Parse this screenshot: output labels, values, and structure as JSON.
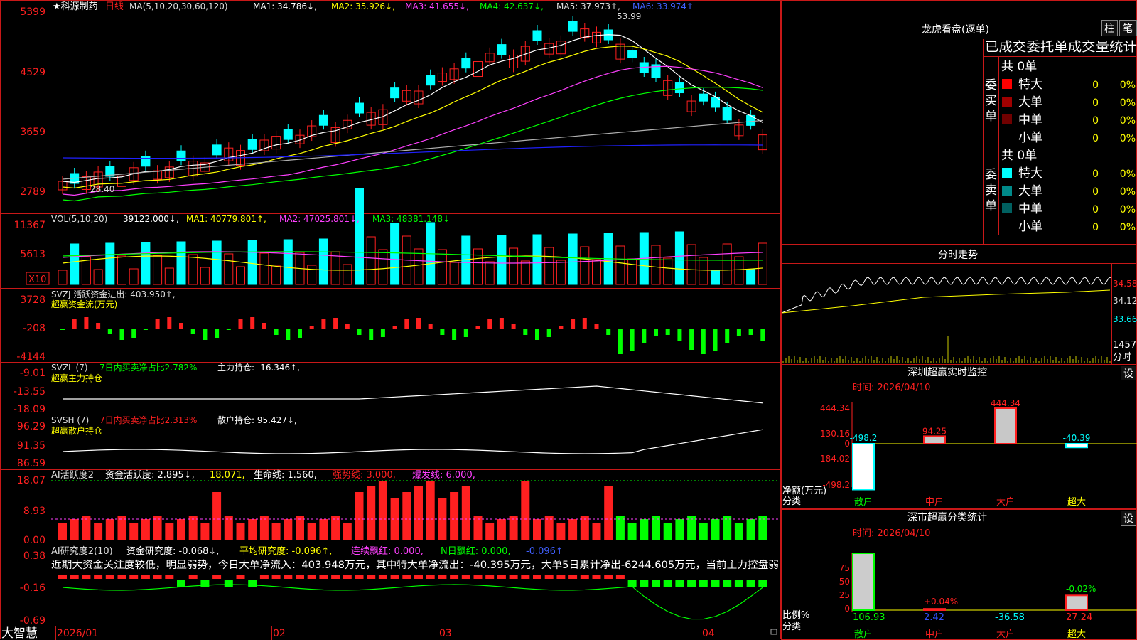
{
  "colors": {
    "up": "#ff2020",
    "down": "#00ffff",
    "grid": "#ff2020",
    "ma_white": "#ffffff",
    "ma_yellow": "#ffff00",
    "ma_magenta": "#ff40ff",
    "ma_green": "#00ff00",
    "ma_gray": "#b0b0b0",
    "ma_blue": "#2020ff"
  },
  "main": {
    "title": "★科源制药",
    "period": "日线",
    "ma_label": "MA(5,10,20,30,60,120)",
    "ma1": "MA1: 34.786↓,",
    "ma2": "MA2: 35.926↓,",
    "ma3": "MA3: 41.655↓,",
    "ma4": "MA4: 42.637↓,",
    "ma5": "MA5: 37.973↑,",
    "ma6": "MA6: 33.974↑",
    "high_mark": "53.99",
    "low_mark": "28.40",
    "y_ticks": [
      "5399",
      "4529",
      "3659",
      "2789"
    ]
  },
  "vol": {
    "label": "VOL(5,10,20)",
    "value": "39122.000↓,",
    "ma1": "MA1: 40779.801↑,",
    "ma2": "MA2: 47025.801↓,",
    "ma3": "MA3: 48381.148↓",
    "y_ticks": [
      "11367",
      "5613"
    ],
    "unit": "X10"
  },
  "svzj": {
    "label": "SVZJ  活跃资金进出: 403.950↑,",
    "sub": "超赢资金流(万元)",
    "y_ticks": [
      "3728",
      "-208",
      "-4144"
    ]
  },
  "svzl": {
    "label1": "SVZL (7)",
    "label2": "7日内买卖净占比2.782%",
    "label3": "主力持仓: -16.346↑,",
    "sub": "超赢主力持仓",
    "y_ticks": [
      "-9.01",
      "-13.55",
      "-18.09"
    ]
  },
  "svsh": {
    "label1": "SVSH (7)",
    "label2": "7日内买卖净占比2.313%",
    "label3": "散户持仓: 95.427↓,",
    "sub": "超赢散户持仓",
    "y_ticks": [
      "96.29",
      "91.35",
      "86.59"
    ]
  },
  "ai1": {
    "label1": "AI活跃度2",
    "label2": "资金活跃度: 2.895↓,",
    "label3": "18.071,",
    "label4": "生命线: 1.560,",
    "label5": "强势线: 3.000,",
    "label6": "爆发线: 6.000,",
    "y_ticks": [
      "18.07",
      "8.93",
      "0.00"
    ]
  },
  "ai2": {
    "label1": "AI研究度2(10)",
    "label2": "资金研究度: -0.068↓,",
    "label3": "平均研究度: -0.096↑,",
    "label4": "连续飘红: 0.000,",
    "label5": "N日飘红: 0.000,",
    "label6": "-0.096↑",
    "note": "近期大资金关注度较低，明显弱势，今日大单净流入：403.948万元，其中特大单净流出：-40.395万元，大单5日累计净出-6244.605万元，当前主力控盘弱",
    "y_ticks": [
      "0.38",
      "-0.16",
      "-0.69"
    ]
  },
  "xaxis": {
    "brand": "大智慧",
    "labels": [
      "2026/01",
      "02",
      "03",
      "04"
    ]
  },
  "lhb": {
    "title": "龙虎看盘(逐单)",
    "btn1": "柱",
    "btn2": "笔",
    "subtitle": "已成交委托单成交量统计",
    "buy_side": "委买单",
    "sell_side": "委卖单",
    "buy_total": "共 0单",
    "sell_total": "共 0单",
    "buy_rows": [
      {
        "name": "特大",
        "n": "0",
        "p": "0%",
        "color": "#ff0000"
      },
      {
        "name": "大单",
        "n": "0",
        "p": "0%",
        "color": "#a00000"
      },
      {
        "name": "中单",
        "n": "0",
        "p": "0%",
        "color": "#700000"
      },
      {
        "name": "小单",
        "n": "0",
        "p": "0%",
        "color": "#000000"
      }
    ],
    "sell_rows": [
      {
        "name": "特大",
        "n": "0",
        "p": "0%",
        "color": "#00ffff"
      },
      {
        "name": "大单",
        "n": "0",
        "p": "0%",
        "color": "#008a8a"
      },
      {
        "name": "中单",
        "n": "0",
        "p": "0%",
        "color": "#006060"
      },
      {
        "name": "小单",
        "n": "0",
        "p": "0%",
        "color": "#000000"
      }
    ]
  },
  "fenshi": {
    "title": "分时走势",
    "prices": [
      "34.58",
      "34.12",
      "33.66"
    ],
    "vol": "1457",
    "vol_unit": "分时"
  },
  "monitor": {
    "title": "深圳超赢实时监控",
    "btn": "设",
    "time": "时间: 2026/04/10",
    "y_ticks": [
      "444.34",
      "130.16",
      "0",
      "-184.02",
      "-498.2"
    ],
    "y_label": "净额(万元)",
    "x_label": "分类",
    "cats": [
      "散户",
      "中户",
      "大户",
      "超大"
    ],
    "values": [
      -498.2,
      94.25,
      444.34,
      -40.39
    ],
    "value_labels": [
      "-498.2",
      "94.25",
      "444.34",
      "-40.39"
    ]
  },
  "stats": {
    "title": "深市超赢分类统计",
    "btn": "设",
    "time": "时间: 2026/04/10",
    "y_ticks": [
      "75",
      "50",
      "25",
      "0"
    ],
    "y_label": "比例%",
    "x_label": "分类",
    "cats": [
      "散户",
      "中户",
      "大户",
      "超大"
    ],
    "values": [
      106.93,
      2.42,
      -36.58,
      27.24
    ],
    "value_labels": [
      "106.93",
      "2.42",
      "-36.58",
      "27.24"
    ],
    "change_labels": [
      "",
      "+0.04%",
      "",
      "-0.02%"
    ]
  }
}
